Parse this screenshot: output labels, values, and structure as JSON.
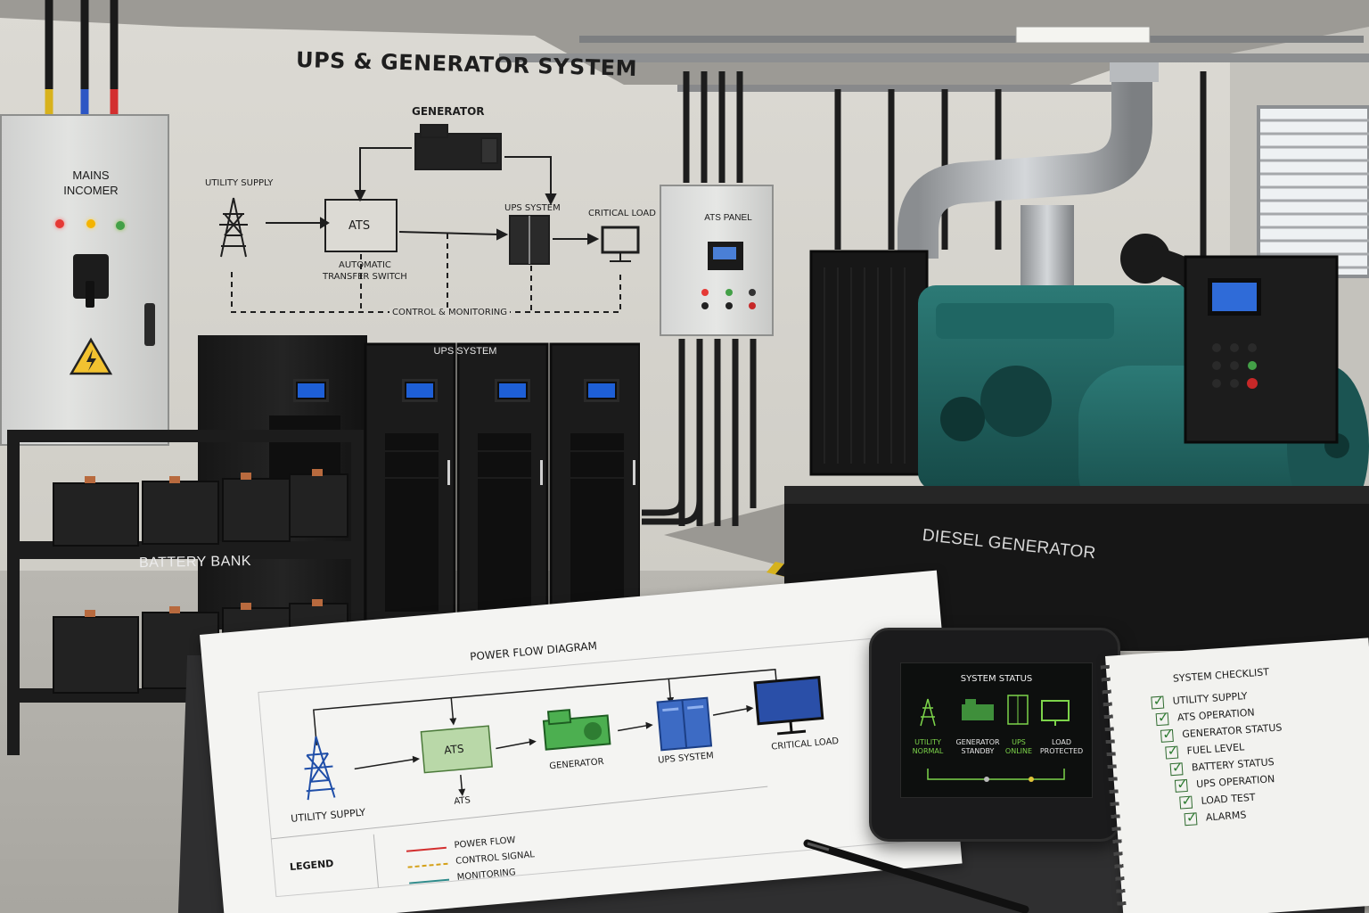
{
  "wall_diagram": {
    "title": "UPS & GENERATOR SYSTEM",
    "generator": "GENERATOR",
    "utility_supply": "UTILITY SUPPLY",
    "ats": "ATS",
    "ats_caption_1": "AUTOMATIC",
    "ats_caption_2": "TRANSFER SWITCH",
    "ups_system": "UPS SYSTEM",
    "critical_load": "CRITICAL LOAD",
    "control_monitoring": "CONTROL & MONITORING"
  },
  "mains_incomer": {
    "line1": "MAINS",
    "line2": "INCOMER"
  },
  "ats_panel": {
    "label": "ATS PANEL"
  },
  "ups_cabinet": {
    "label": "UPS SYSTEM"
  },
  "battery_bank": {
    "label": "BATTERY BANK"
  },
  "diesel_generator": {
    "label": "DIESEL GENERATOR"
  },
  "power_flow_sheet": {
    "title": "POWER FLOW DIAGRAM",
    "ats_box": "ATS",
    "utility_supply": "UTILITY SUPPLY",
    "ats": "ATS",
    "generator": "GENERATOR",
    "ups_system": "UPS SYSTEM",
    "critical_load": "CRITICAL LOAD",
    "legend_title": "LEGEND",
    "legend": [
      {
        "label": "POWER FLOW",
        "color": "#d32f2f"
      },
      {
        "label": "CONTROL SIGNAL",
        "color": "#d4a017"
      },
      {
        "label": "MONITORING",
        "color": "#2e8b8b"
      }
    ]
  },
  "tablet": {
    "title": "SYSTEM STATUS",
    "items": [
      {
        "line1": "UTILITY",
        "line2": "NORMAL",
        "color": "#7cd44a"
      },
      {
        "line1": "GENERATOR",
        "line2": "STANDBY",
        "color": "#e6e6e6"
      },
      {
        "line1": "UPS",
        "line2": "ONLINE",
        "color": "#7cd44a"
      },
      {
        "line1": "LOAD",
        "line2": "PROTECTED",
        "color": "#e6e6e6"
      }
    ]
  },
  "checklist": {
    "title": "SYSTEM CHECKLIST",
    "items": [
      "UTILITY SUPPLY",
      "ATS OPERATION",
      "GENERATOR STATUS",
      "FUEL LEVEL",
      "BATTERY STATUS",
      "UPS OPERATION",
      "LOAD TEST",
      "ALARMS"
    ]
  },
  "colors": {
    "wall": "#d8d6d0",
    "generator_body": "#1e5f5c",
    "cabinet": "#1a1a1a",
    "lcd": "#1e5fd6",
    "tablet_accent": "#7cd44a"
  }
}
